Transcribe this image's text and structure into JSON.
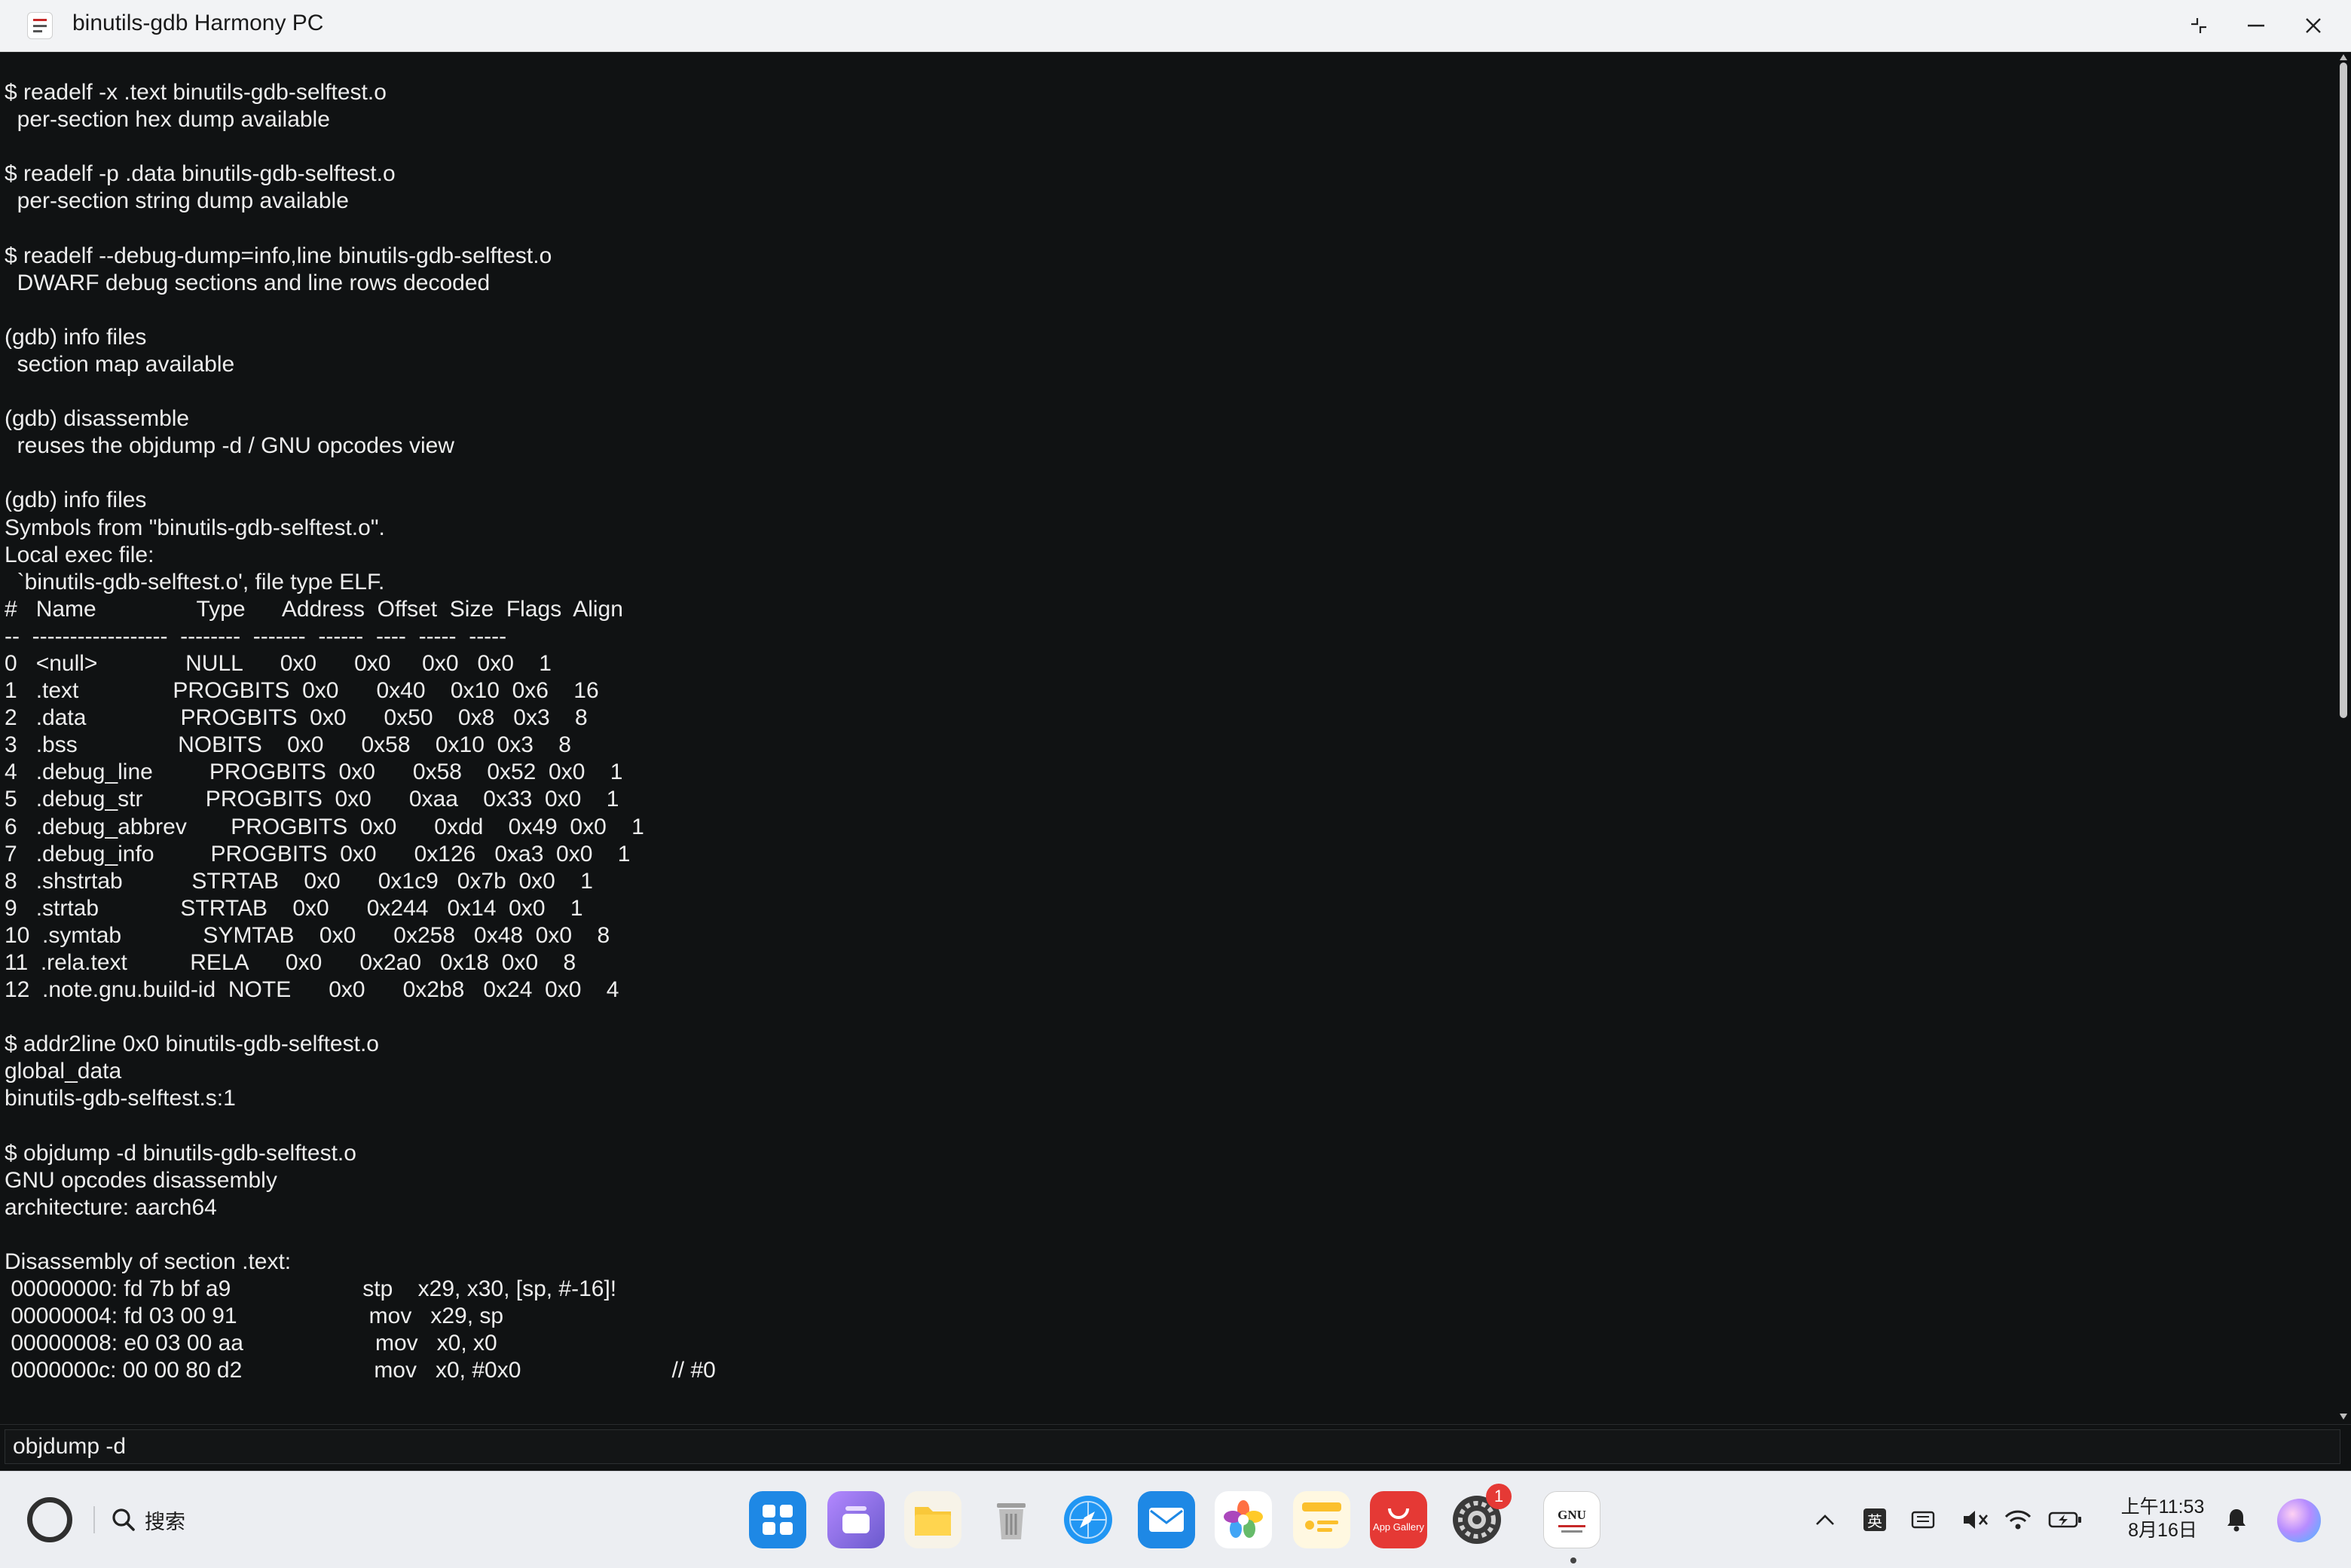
{
  "window": {
    "title": "binutils-gdb Harmony PC"
  },
  "terminal": {
    "lines": [
      "$ readelf -x .text binutils-gdb-selftest.o",
      "  per-section hex dump available",
      "",
      "$ readelf -p .data binutils-gdb-selftest.o",
      "  per-section string dump available",
      "",
      "$ readelf --debug-dump=info,line binutils-gdb-selftest.o",
      "  DWARF debug sections and line rows decoded",
      "",
      "(gdb) info files",
      "  section map available",
      "",
      "(gdb) disassemble",
      "  reuses the objdump -d / GNU opcodes view",
      "",
      "(gdb) info files",
      "Symbols from \"binutils-gdb-selftest.o\".",
      "Local exec file:",
      "  `binutils-gdb-selftest.o', file type ELF.",
      "#   Name                Type      Address  Offset  Size  Flags  Align",
      "--  ------------------  --------  -------  ------  ----  -----  -----",
      "0   <null>              NULL      0x0      0x0     0x0   0x0    1",
      "1   .text               PROGBITS  0x0      0x40    0x10  0x6    16",
      "2   .data               PROGBITS  0x0      0x50    0x8   0x3    8",
      "3   .bss                NOBITS    0x0      0x58    0x10  0x3    8",
      "4   .debug_line         PROGBITS  0x0      0x58    0x52  0x0    1",
      "5   .debug_str          PROGBITS  0x0      0xaa    0x33  0x0    1",
      "6   .debug_abbrev       PROGBITS  0x0      0xdd    0x49  0x0    1",
      "7   .debug_info         PROGBITS  0x0      0x126   0xa3  0x0    1",
      "8   .shstrtab           STRTAB    0x0      0x1c9   0x7b  0x0    1",
      "9   .strtab             STRTAB    0x0      0x244   0x14  0x0    1",
      "10  .symtab             SYMTAB    0x0      0x258   0x48  0x0    8",
      "11  .rela.text          RELA      0x0      0x2a0   0x18  0x0    8",
      "12  .note.gnu.build-id  NOTE      0x0      0x2b8   0x24  0x0    4",
      "",
      "$ addr2line 0x0 binutils-gdb-selftest.o",
      "global_data",
      "binutils-gdb-selftest.s:1",
      "",
      "$ objdump -d binutils-gdb-selftest.o",
      "GNU opcodes disassembly",
      "architecture: aarch64",
      "",
      "Disassembly of section .text:",
      " 00000000: fd 7b bf a9                     stp    x29, x30, [sp, #-16]!",
      " 00000004: fd 03 00 91                     mov   x29, sp",
      " 00000008: e0 03 00 aa                     mov   x0, x0",
      " 0000000c: 00 00 80 d2                     mov   x0, #0x0                        // #0"
    ],
    "scroll_position": 0.46
  },
  "command_input": {
    "value": "objdump -d"
  },
  "taskbar": {
    "search_label": "搜索",
    "dock": [
      {
        "name": "app-center-icon",
        "color": "#1e88e5"
      },
      {
        "name": "multitask-icon",
        "color": "#7e57c2"
      },
      {
        "name": "files-icon",
        "color": "#fbc02d"
      },
      {
        "name": "trash-icon",
        "color": "#9e9e9e"
      },
      {
        "name": "browser-icon",
        "color": "#1e88e5"
      },
      {
        "name": "mail-icon",
        "color": "#1e88e5"
      },
      {
        "name": "photos-icon",
        "color": "#ec407a"
      },
      {
        "name": "notes-icon",
        "color": "#fbc02d"
      },
      {
        "name": "app-gallery-icon",
        "color": "#e53935",
        "label": "App Gallery"
      },
      {
        "name": "settings-icon",
        "color": "#444444",
        "badge": "1"
      },
      {
        "name": "gnu-binutils-icon",
        "color": "#ffffff",
        "label": "GNU"
      }
    ],
    "tray": {
      "ime_label": "英",
      "time": "上午11:53",
      "date": "8月16日"
    }
  }
}
